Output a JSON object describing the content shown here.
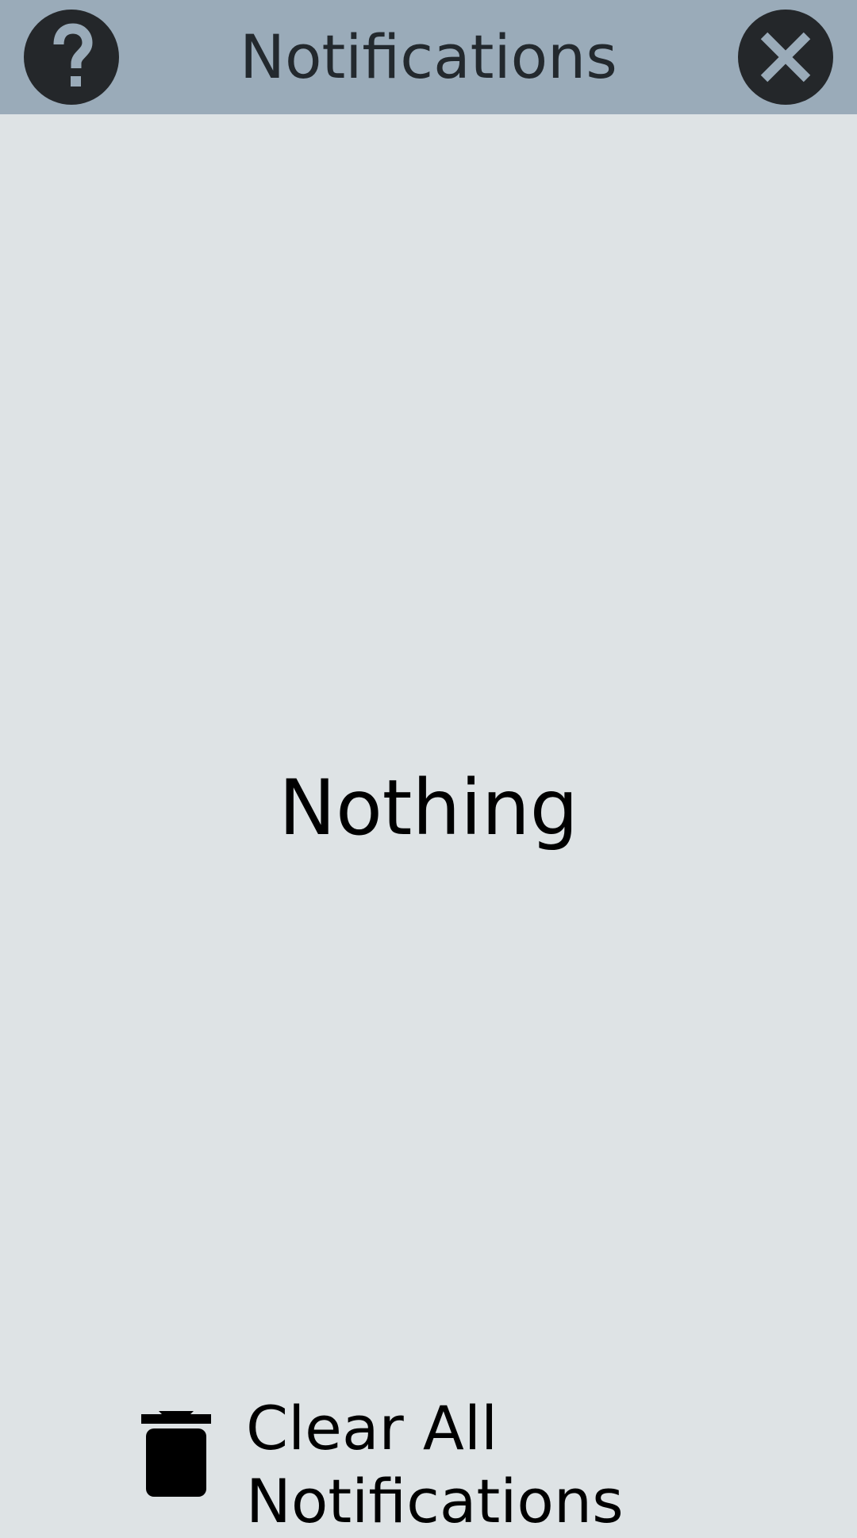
{
  "header": {
    "title": "Notifications",
    "help_icon": "question-mark-icon",
    "close_icon": "close-icon",
    "background_color": "#9aabb9"
  },
  "main": {
    "empty_message": "Nothing",
    "background_color": "#dee3e5"
  },
  "footer": {
    "clear_all_label": "Clear All Notifications",
    "clear_all_icon": "trash-icon"
  }
}
